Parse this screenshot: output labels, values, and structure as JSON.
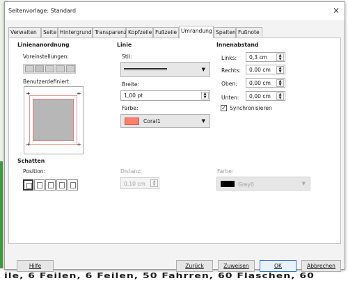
{
  "dialog": {
    "title": "Seitenvorlage: Standard",
    "close_glyph": "×"
  },
  "tabs": [
    {
      "label": "Verwalten"
    },
    {
      "label": "Seite"
    },
    {
      "label": "Hintergrund"
    },
    {
      "label": "Transparenz"
    },
    {
      "label": "Kopfzeile"
    },
    {
      "label": "Fußzeile"
    },
    {
      "label": "Umrandung",
      "active": true
    },
    {
      "label": "Spalten"
    },
    {
      "label": "Fußnote"
    }
  ],
  "line_arrangement": {
    "heading": "Linienanordnung",
    "presets_label": "Voreinstellungen:",
    "user_defined_label": "Benutzerdefiniert:"
  },
  "line": {
    "heading": "Linie",
    "style_label": "Stil:",
    "width_label": "Breite:",
    "width_value": "1,00 pt",
    "color_label": "Farbe:",
    "color_name": "Coral1",
    "color_hex": "#ff7f6f"
  },
  "padding": {
    "heading": "Innenabstand",
    "left_label": "Links:",
    "left_value": "0,3 cm",
    "right_label": "Rechts:",
    "right_value": "0,00 cm",
    "top_label": "Oben:",
    "top_value": "0,00 cm",
    "bottom_label": "Unten:",
    "bottom_value": "0,00 cm",
    "sync_label": "Synchronisieren",
    "sync_checked": true
  },
  "shadow": {
    "heading": "Schatten",
    "position_label": "Position:",
    "distance_label": "Distanz:",
    "distance_value": "0,10 cm",
    "color_label": "Farbe:",
    "color_name": "Grey0",
    "color_hex": "#000000"
  },
  "buttons": {
    "help": "Hilfe",
    "back": "Zurück",
    "assign": "Zuweisen",
    "ok": "OK",
    "cancel": "Abbrechen"
  },
  "background_doc": {
    "text": "ile, 6 Feilen, 6 Feilen, 50 Fahrren, 60 Flaschen, 60"
  },
  "icons": {
    "spin_up": "▲",
    "spin_down": "▼",
    "dropdown": "▼",
    "corner_marker": "+",
    "check": "✓"
  }
}
